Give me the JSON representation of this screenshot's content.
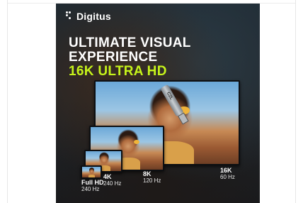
{
  "brand": {
    "name": "Digitus"
  },
  "headline": {
    "line1": "ULTIMATE VISUAL",
    "line2": "EXPERIENCE",
    "line3": "16K ULTRA HD"
  },
  "cable_label": "CZL",
  "resolutions": [
    {
      "res": "Full HD",
      "hz": "240 Hz"
    },
    {
      "res": "4K",
      "hz": "240 Hz"
    },
    {
      "res": "8K",
      "hz": "120 Hz"
    },
    {
      "res": "16K",
      "hz": "60 Hz"
    }
  ],
  "colors": {
    "accent": "#c6f31b",
    "text": "#ffffff",
    "background": "#1e2a33"
  }
}
